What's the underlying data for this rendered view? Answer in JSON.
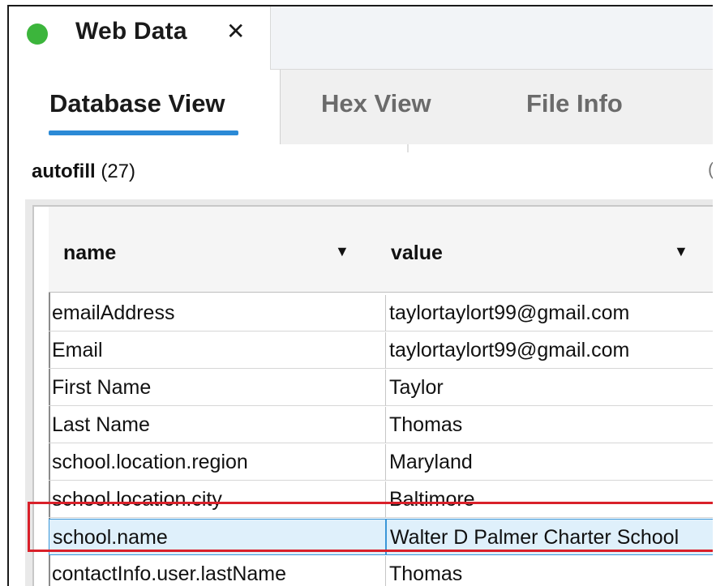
{
  "window": {
    "file_tab_title": "Web Data",
    "close_glyph": "✕",
    "status_color": "#3cb53c"
  },
  "view_tabs": [
    {
      "label": "Database View",
      "active": true
    },
    {
      "label": "Hex View",
      "active": false
    },
    {
      "label": "File Info",
      "active": false
    }
  ],
  "table": {
    "name": "autofill",
    "count": "(27)"
  },
  "grid": {
    "columns": [
      {
        "label": "name",
        "icon": "caret-down-icon"
      },
      {
        "label": "value",
        "icon": "caret-down-icon"
      }
    ],
    "rows": [
      {
        "name": "emailAddress",
        "value": "taylortaylort99@gmail.com"
      },
      {
        "name": "Email",
        "value": "taylortaylort99@gmail.com"
      },
      {
        "name": "First Name",
        "value": "Taylor"
      },
      {
        "name": "Last Name",
        "value": "Thomas"
      },
      {
        "name": "school.location.region",
        "value": "Maryland"
      },
      {
        "name": "school.location.city",
        "value": "Baltimore"
      },
      {
        "name": "school.name",
        "value": "Walter D Palmer Charter School",
        "selected": true
      },
      {
        "name": "contactInfo.user.lastName",
        "value": "Thomas"
      }
    ]
  },
  "colors": {
    "accent": "#2b8ad6",
    "selection_bg": "#dff0fb",
    "highlight_outline": "#d9202a"
  }
}
